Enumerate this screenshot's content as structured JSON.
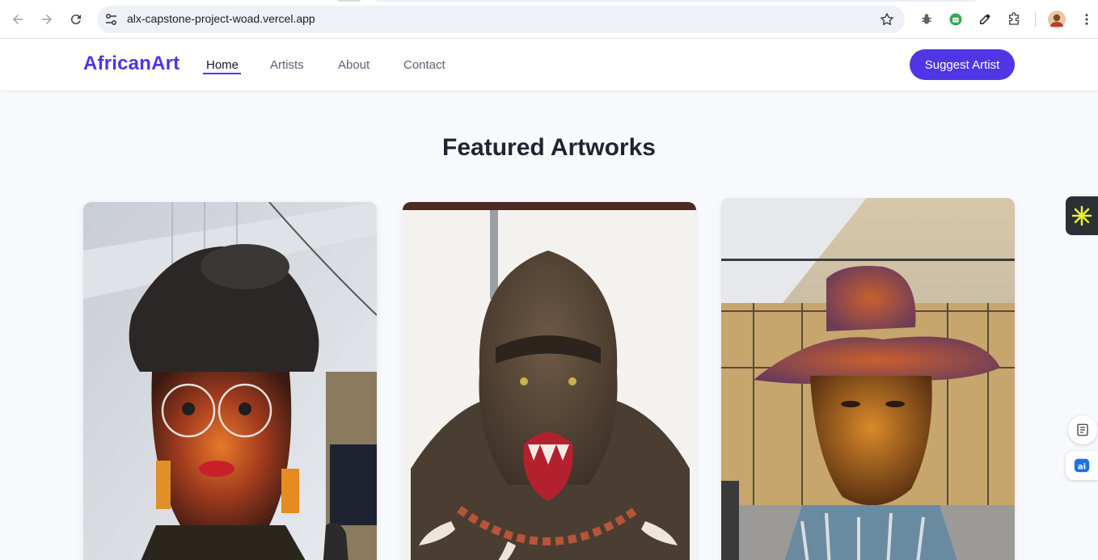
{
  "browser": {
    "url": "alx-capstone-project-woad.vercel.app",
    "back_icon": "arrow-left-icon",
    "forward_icon": "arrow-right-icon",
    "reload_icon": "reload-icon",
    "site_info_icon": "tune-icon",
    "bookmark_icon": "star-icon",
    "extensions": [
      "bug-icon",
      "robot-icon",
      "eyedropper-icon",
      "puzzle-icon"
    ],
    "profile_icon": "avatar",
    "menu_icon": "kebab-menu-icon"
  },
  "site": {
    "logo": "AfricanArt",
    "nav": [
      {
        "label": "Home",
        "active": true
      },
      {
        "label": "Artists",
        "active": false
      },
      {
        "label": "About",
        "active": false
      },
      {
        "label": "Contact",
        "active": false
      }
    ],
    "cta_label": "Suggest Artist",
    "accent_color": "#4f35e6"
  },
  "main": {
    "section_title": "Featured Artworks",
    "artworks": [
      {
        "subject": "woman-sculpture-with-glasses"
      },
      {
        "subject": "gorilla-sculpture"
      },
      {
        "subject": "man-with-hat-sculpture"
      }
    ]
  },
  "side_widgets": [
    "sparkle-icon",
    "notes-icon",
    "ai-icon"
  ]
}
